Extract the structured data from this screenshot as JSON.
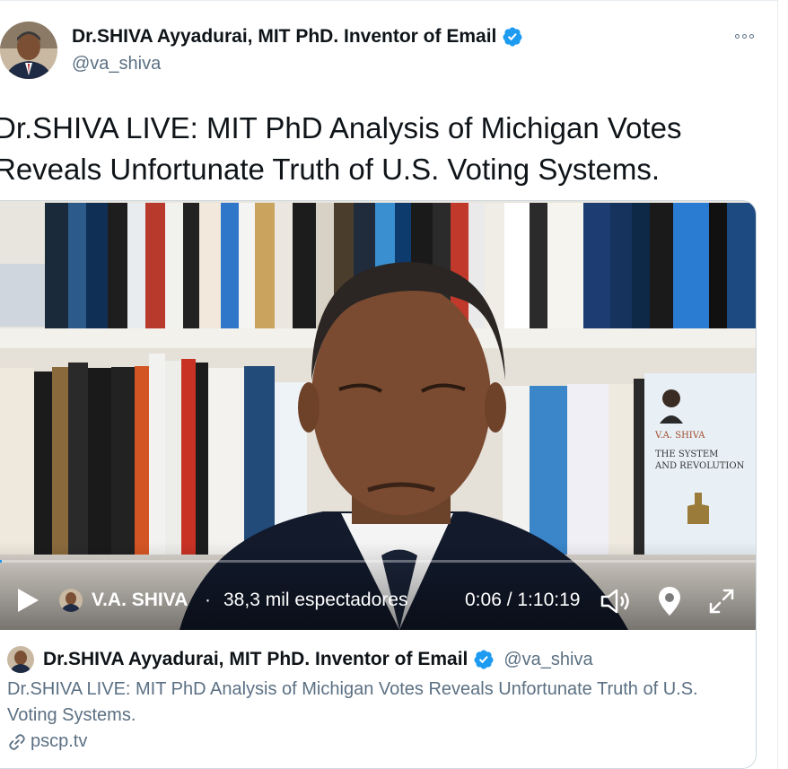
{
  "author": {
    "name": "Dr.SHIVA Ayyadurai, MIT PhD. Inventor of Email",
    "handle": "@va_shiva",
    "verified": true
  },
  "tweet": {
    "text": "Dr.SHIVA LIVE: MIT PhD Analysis of Michigan Votes Reveals Unfortunate Truth of U.S. Voting Systems."
  },
  "video": {
    "broadcaster": "V.A. SHIVA",
    "separator": "·",
    "viewers": "38,3 mil espectadores",
    "time": "0:06 / 1:10:19",
    "progress_fraction": 0.0015
  },
  "card": {
    "name": "Dr.SHIVA Ayyadurai, MIT PhD. Inventor of Email",
    "handle": "@va_shiva",
    "description": "Dr.SHIVA LIVE: MIT PhD Analysis of Michigan Votes Reveals Unfortunate Truth of U.S. Voting Systems.",
    "domain": "pscp.tv"
  },
  "colors": {
    "verified": "#1d9bf0",
    "secondary_text": "#5b7083",
    "border": "#cfd9de"
  },
  "icons": [
    "verified-badge-icon",
    "more-options-icon",
    "play-icon",
    "volume-icon",
    "location-pin-icon",
    "fullscreen-icon",
    "link-icon"
  ]
}
